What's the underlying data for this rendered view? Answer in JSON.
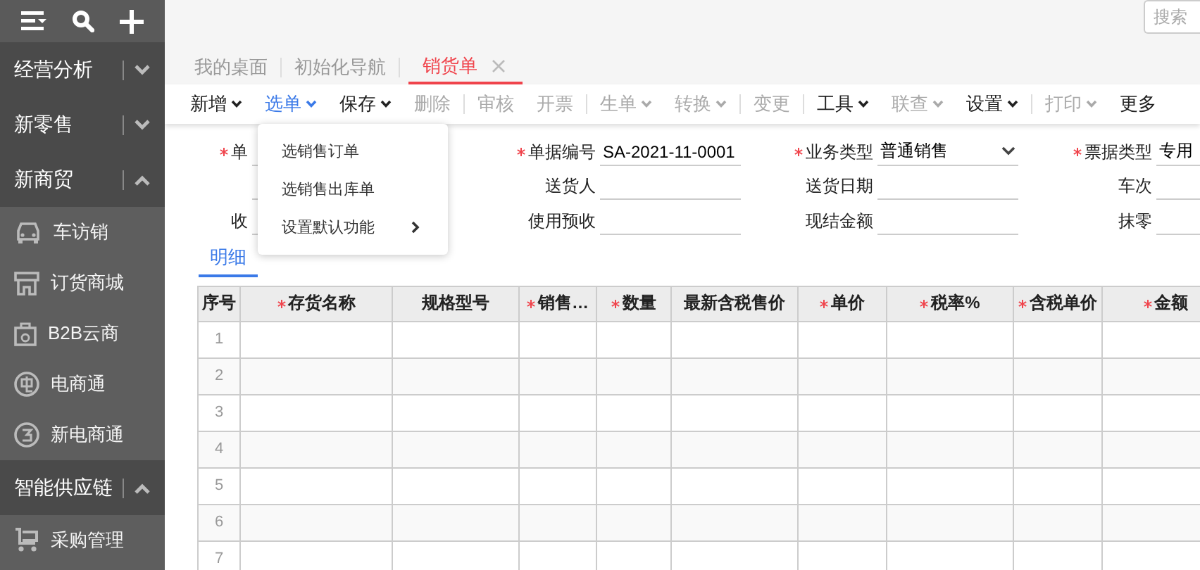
{
  "sidebar": {
    "sections": [
      {
        "title": "经营分析",
        "expanded": false
      },
      {
        "title": "新零售",
        "expanded": false
      },
      {
        "title": "新商贸",
        "expanded": true,
        "children": [
          {
            "label": "车访销"
          },
          {
            "label": "订货商城"
          },
          {
            "label": "B2B云商"
          },
          {
            "label": "电商通"
          },
          {
            "label": "新电商通"
          }
        ]
      },
      {
        "title": "智能供应链",
        "expanded": true,
        "children": [
          {
            "label": "采购管理"
          }
        ]
      }
    ]
  },
  "search": {
    "placeholder": "搜索"
  },
  "tabs": [
    {
      "label": "我的桌面",
      "selected": false,
      "closable": false
    },
    {
      "label": "初始化导航",
      "selected": false,
      "closable": false
    },
    {
      "label": "销货单",
      "selected": true,
      "closable": true
    }
  ],
  "toolbar": [
    {
      "label": "新增",
      "has_menu": true,
      "disabled": false,
      "open": false,
      "divider_before": false
    },
    {
      "label": "选单",
      "has_menu": true,
      "disabled": false,
      "open": true,
      "divider_before": false
    },
    {
      "label": "保存",
      "has_menu": true,
      "disabled": false,
      "open": false,
      "divider_before": false
    },
    {
      "label": "删除",
      "has_menu": false,
      "disabled": true,
      "open": false,
      "divider_before": false
    },
    {
      "label": "审核",
      "has_menu": false,
      "disabled": true,
      "open": false,
      "divider_before": true
    },
    {
      "label": "开票",
      "has_menu": false,
      "disabled": true,
      "open": false,
      "divider_before": false
    },
    {
      "label": "生单",
      "has_menu": true,
      "disabled": true,
      "open": false,
      "divider_before": true
    },
    {
      "label": "转换",
      "has_menu": true,
      "disabled": true,
      "open": false,
      "divider_before": false
    },
    {
      "label": "变更",
      "has_menu": false,
      "disabled": true,
      "open": false,
      "divider_before": true
    },
    {
      "label": "工具",
      "has_menu": true,
      "disabled": false,
      "open": false,
      "divider_before": true
    },
    {
      "label": "联查",
      "has_menu": true,
      "disabled": true,
      "open": false,
      "divider_before": false
    },
    {
      "label": "设置",
      "has_menu": true,
      "disabled": false,
      "open": false,
      "divider_before": false
    },
    {
      "label": "打印",
      "has_menu": true,
      "disabled": true,
      "open": false,
      "divider_before": true
    },
    {
      "label": "更多",
      "has_menu": false,
      "disabled": false,
      "open": false,
      "divider_before": false
    }
  ],
  "dropdown_menu": [
    {
      "label": "选销售订单",
      "has_submenu": false
    },
    {
      "label": "选销售出库单",
      "has_submenu": false
    },
    {
      "label": "设置默认功能",
      "has_submenu": true
    }
  ],
  "form": {
    "columns": [
      [
        {
          "label": "单",
          "required": true
        },
        {
          "required": false
        },
        {
          "label": "收",
          "required": false
        }
      ],
      [
        {
          "label": "单据编号",
          "required": true,
          "value": "SA-2021-11-0001"
        },
        {
          "label": "送货人",
          "required": false
        },
        {
          "label": "使用预收",
          "required": false
        }
      ],
      [
        {
          "label": "业务类型",
          "required": true,
          "value": "普通销售",
          "select": true
        },
        {
          "label": "送货日期",
          "required": false
        },
        {
          "label": "现结金额",
          "required": false
        }
      ],
      [
        {
          "label": "票据类型",
          "required": true,
          "value": "专用"
        },
        {
          "label": "车次",
          "required": false
        },
        {
          "label": "抹零",
          "required": false
        }
      ]
    ]
  },
  "detail_tab": {
    "label": "明细",
    "selected": true
  },
  "table": {
    "columns": [
      {
        "label": "序号",
        "required": false
      },
      {
        "label": "存货名称",
        "required": true
      },
      {
        "label": "规格型号",
        "required": false
      },
      {
        "label": "销售…",
        "required": true
      },
      {
        "label": "数量",
        "required": true
      },
      {
        "label": "最新含税售价",
        "required": false
      },
      {
        "label": "单价",
        "required": true
      },
      {
        "label": "税率%",
        "required": true
      },
      {
        "label": "含税单价",
        "required": true
      },
      {
        "label": "金额",
        "required": true
      }
    ],
    "rows": [
      "1",
      "2",
      "3",
      "4",
      "5",
      "6",
      "7"
    ]
  }
}
